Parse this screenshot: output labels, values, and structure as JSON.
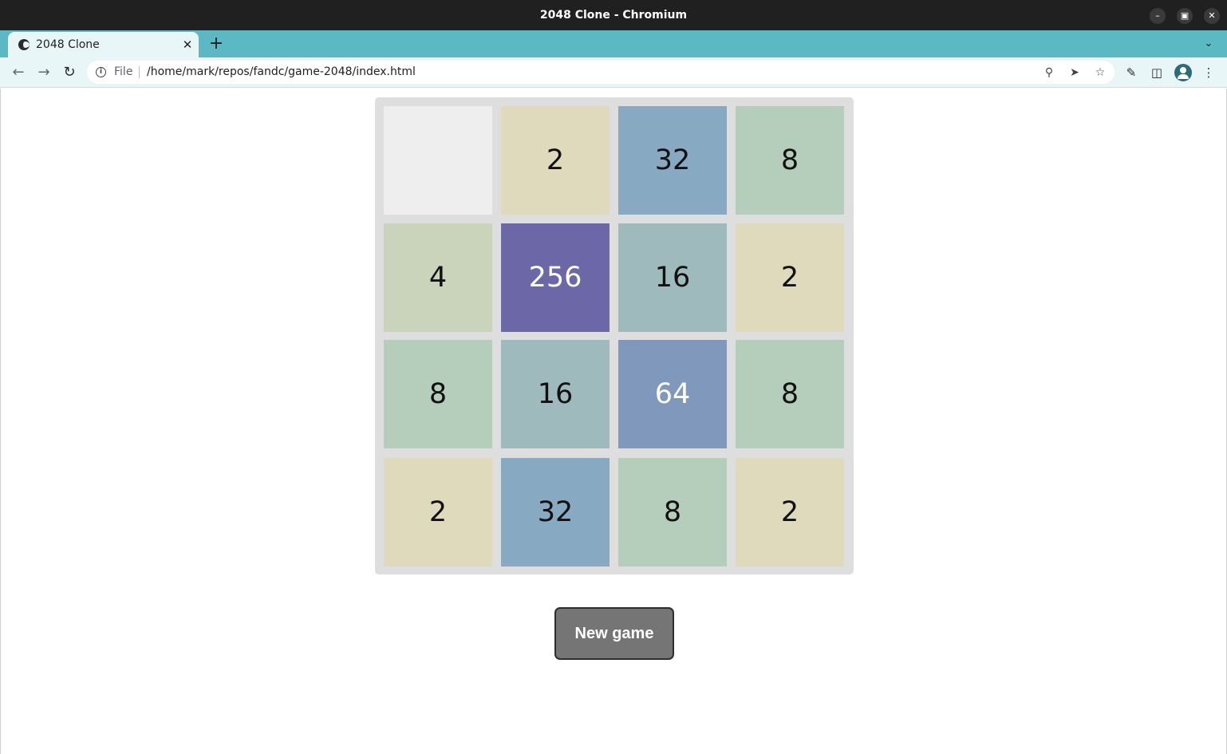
{
  "window": {
    "title": "2048 Clone - Chromium",
    "minimize_icon": "minimize-icon",
    "maximize_icon": "maximize-icon",
    "close_icon": "close-icon"
  },
  "tabs": [
    {
      "title": "2048 Clone",
      "icon": "globe-icon",
      "active": true
    }
  ],
  "toolbar": {
    "scheme_label": "File",
    "url": "/home/mark/repos/fandc/game-2048/index.html"
  },
  "game": {
    "grid": [
      [
        "",
        "2",
        "32",
        "8"
      ],
      [
        "4",
        "256",
        "16",
        "2"
      ],
      [
        "8",
        "16",
        "64",
        "8"
      ],
      [
        "2",
        "32",
        "8",
        "2"
      ]
    ],
    "tile_colors": {
      "": "#eeeeee",
      "2": "#dfdabb",
      "4": "#c9d4bb",
      "8": "#b5cdbb",
      "16": "#9fbabc",
      "32": "#87aac2",
      "64": "#7f98bb",
      "256": "#6c67a6"
    },
    "light_text_values": [
      "64",
      "256"
    ],
    "new_game_label": "New game"
  }
}
